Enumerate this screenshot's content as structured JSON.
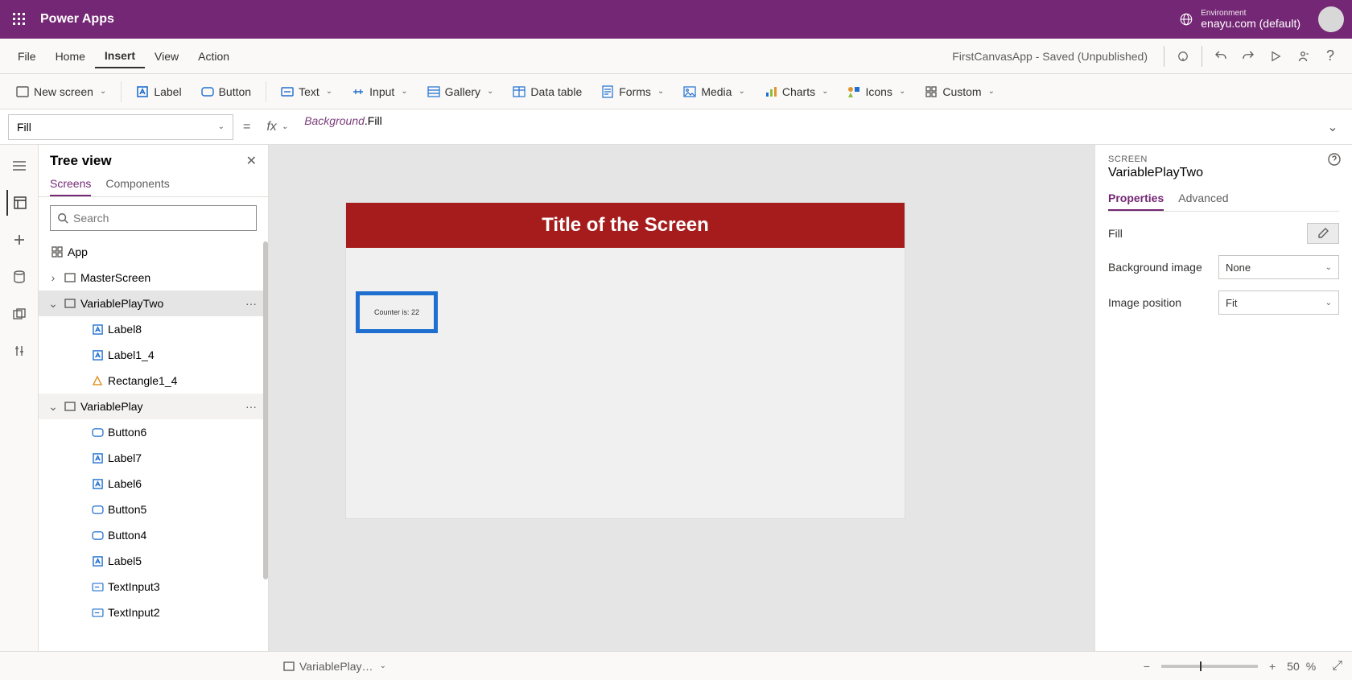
{
  "topbar": {
    "app_name": "Power Apps",
    "env_label": "Environment",
    "env_name": "enayu.com (default)"
  },
  "menubar": {
    "items": [
      "File",
      "Home",
      "Insert",
      "View",
      "Action"
    ],
    "active_index": 2,
    "app_status": "FirstCanvasApp - Saved (Unpublished)"
  },
  "ribbon": {
    "new_screen": "New screen",
    "label": "Label",
    "button": "Button",
    "text": "Text",
    "input": "Input",
    "gallery": "Gallery",
    "data_table": "Data table",
    "forms": "Forms",
    "media": "Media",
    "charts": "Charts",
    "icons": "Icons",
    "custom": "Custom"
  },
  "formula": {
    "property": "Fill",
    "expression_ref": "Background",
    "expression_tail": ".Fill"
  },
  "tree": {
    "title": "Tree view",
    "tabs": {
      "screens": "Screens",
      "components": "Components"
    },
    "search_placeholder": "Search",
    "app_label": "App",
    "items": [
      {
        "label": "MasterScreen",
        "depth": 1,
        "icon": "screen",
        "expand": ">"
      },
      {
        "label": "VariablePlayTwo",
        "depth": 1,
        "icon": "screen",
        "expand": "v",
        "selected": true,
        "more": true
      },
      {
        "label": "Label8",
        "depth": 2,
        "icon": "label"
      },
      {
        "label": "Label1_4",
        "depth": 2,
        "icon": "label"
      },
      {
        "label": "Rectangle1_4",
        "depth": 2,
        "icon": "shape"
      },
      {
        "label": "VariablePlay",
        "depth": 1,
        "icon": "screen",
        "expand": "v",
        "hover": true,
        "more": true
      },
      {
        "label": "Button6",
        "depth": 2,
        "icon": "button"
      },
      {
        "label": "Label7",
        "depth": 2,
        "icon": "label"
      },
      {
        "label": "Label6",
        "depth": 2,
        "icon": "label"
      },
      {
        "label": "Button5",
        "depth": 2,
        "icon": "button"
      },
      {
        "label": "Button4",
        "depth": 2,
        "icon": "button"
      },
      {
        "label": "Label5",
        "depth": 2,
        "icon": "label"
      },
      {
        "label": "TextInput3",
        "depth": 2,
        "icon": "textinput"
      },
      {
        "label": "TextInput2",
        "depth": 2,
        "icon": "textinput"
      }
    ]
  },
  "canvas": {
    "title_text": "Title of the Screen",
    "counter_text": "Counter is: 22"
  },
  "props": {
    "type_label": "SCREEN",
    "name": "VariablePlayTwo",
    "tabs": {
      "properties": "Properties",
      "advanced": "Advanced"
    },
    "rows": {
      "fill_label": "Fill",
      "bgimg_label": "Background image",
      "bgimg_value": "None",
      "imgpos_label": "Image position",
      "imgpos_value": "Fit"
    }
  },
  "bottombar": {
    "crumb": "VariablePlay…",
    "zoom_value": "50",
    "zoom_pct": "%"
  },
  "glyphs": {
    "chev_down": "⌄",
    "chev_right": "›",
    "close": "✕",
    "more": "···",
    "help": "?",
    "minus": "−",
    "plus": "+",
    "expand": "⤢"
  }
}
